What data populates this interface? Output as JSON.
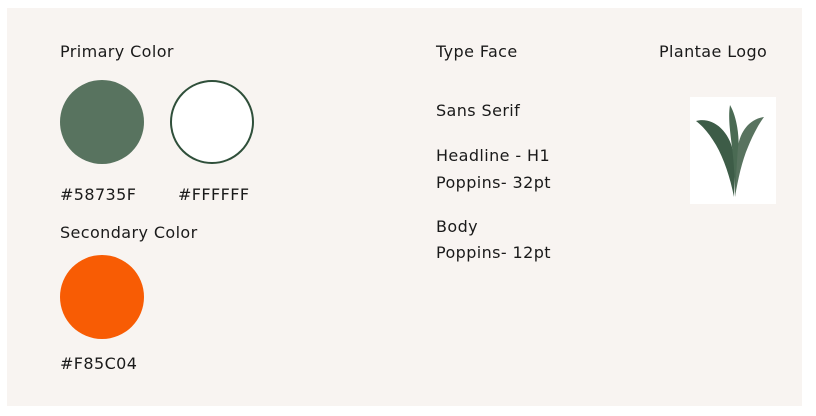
{
  "primary": {
    "heading": "Primary Color",
    "swatches": [
      {
        "hex_label": "#58735F",
        "color": "#58735F"
      },
      {
        "hex_label": "#FFFFFF",
        "color": "#FFFFFF"
      }
    ]
  },
  "secondary": {
    "heading": "Secondary Color",
    "swatches": [
      {
        "hex_label": "#F85C04",
        "color": "#F85C04"
      }
    ]
  },
  "typeface": {
    "heading": "Type Face",
    "style": "Sans Serif",
    "headline_label": "Headline - H1",
    "headline_spec": "Poppins- 32pt",
    "body_label": "Body",
    "body_spec": "Poppins- 12pt"
  },
  "logo": {
    "heading": "Plantae Logo",
    "icon": "plant-leaf-logo",
    "colors": {
      "leaf_dark": "#3d5c47",
      "leaf_light": "#58735F",
      "background": "#FFFFFF"
    }
  },
  "colors": {
    "card_background": "#f8f4f1",
    "text": "#1a1a1a",
    "white_swatch_border": "#2f4f3a"
  }
}
